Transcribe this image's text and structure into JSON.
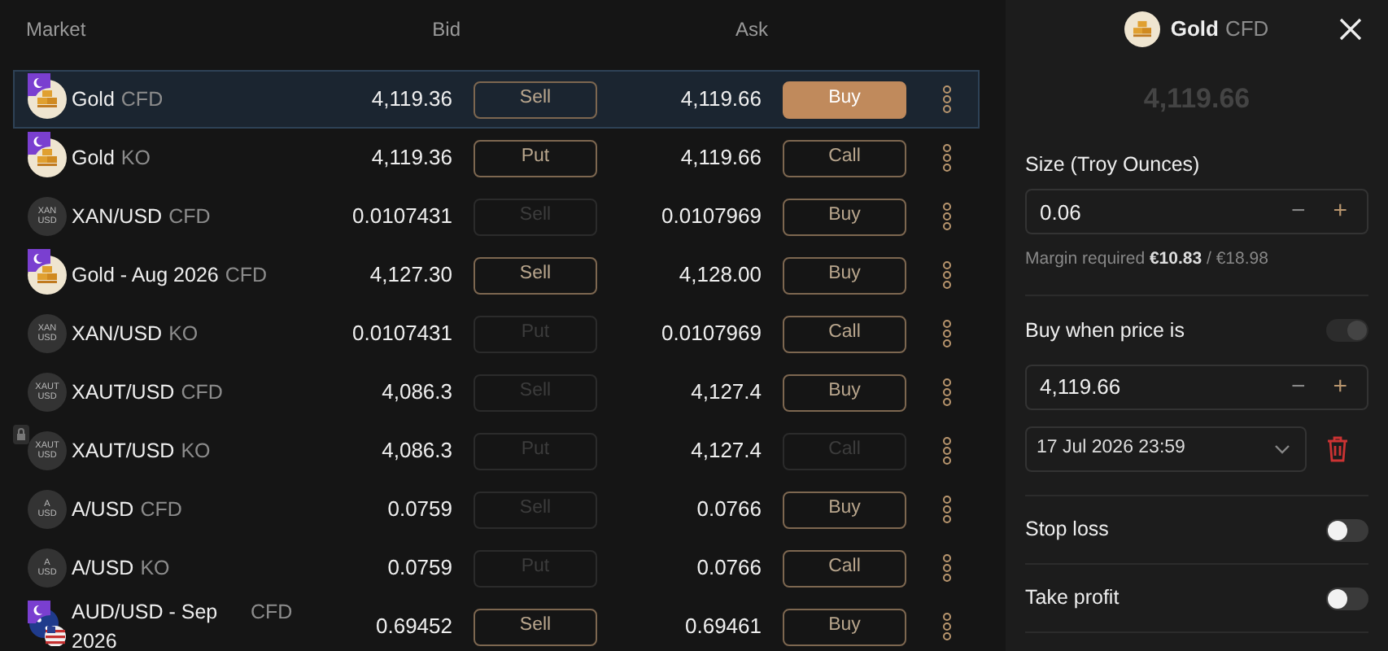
{
  "columns": {
    "market": "Market",
    "bid": "Bid",
    "ask": "Ask"
  },
  "rows": [
    {
      "name": "Gold",
      "type": "CFD",
      "kind": "bullion",
      "closed": true,
      "locked": false,
      "bid": "4,119.36",
      "sell": "Sell",
      "sell_enabled": true,
      "ask": "4,119.66",
      "buy": "Buy",
      "buy_enabled": true,
      "selected": true
    },
    {
      "name": "Gold",
      "type": "KO",
      "kind": "bullion",
      "closed": true,
      "locked": false,
      "bid": "4,119.36",
      "sell": "Put",
      "sell_enabled": true,
      "ask": "4,119.66",
      "buy": "Call",
      "buy_enabled": true,
      "selected": false
    },
    {
      "name": "XAN/USD",
      "type": "CFD",
      "kind": "coin",
      "icon_text": [
        "XAN",
        "USD"
      ],
      "closed": false,
      "locked": false,
      "bid": "0.0107431",
      "sell": "Sell",
      "sell_enabled": false,
      "ask": "0.0107969",
      "buy": "Buy",
      "buy_enabled": true,
      "selected": false
    },
    {
      "name": "Gold - Aug 2026",
      "type": "CFD",
      "kind": "bullion",
      "closed": true,
      "locked": false,
      "bid": "4,127.30",
      "sell": "Sell",
      "sell_enabled": true,
      "ask": "4,128.00",
      "buy": "Buy",
      "buy_enabled": true,
      "selected": false
    },
    {
      "name": "XAN/USD",
      "type": "KO",
      "kind": "coin",
      "icon_text": [
        "XAN",
        "USD"
      ],
      "closed": false,
      "locked": false,
      "bid": "0.0107431",
      "sell": "Put",
      "sell_enabled": false,
      "ask": "0.0107969",
      "buy": "Call",
      "buy_enabled": true,
      "selected": false
    },
    {
      "name": "XAUT/USD",
      "type": "CFD",
      "kind": "coin",
      "icon_text": [
        "XAUT",
        "USD"
      ],
      "closed": false,
      "locked": false,
      "bid": "4,086.3",
      "sell": "Sell",
      "sell_enabled": false,
      "ask": "4,127.4",
      "buy": "Buy",
      "buy_enabled": true,
      "selected": false
    },
    {
      "name": "XAUT/USD",
      "type": "KO",
      "kind": "coin",
      "icon_text": [
        "XAUT",
        "USD"
      ],
      "closed": false,
      "locked": true,
      "bid": "4,086.3",
      "sell": "Put",
      "sell_enabled": false,
      "ask": "4,127.4",
      "buy": "Call",
      "buy_enabled": false,
      "selected": false
    },
    {
      "name": "A/USD",
      "type": "CFD",
      "kind": "coin",
      "icon_text": [
        "A",
        "USD"
      ],
      "closed": false,
      "locked": false,
      "bid": "0.0759",
      "sell": "Sell",
      "sell_enabled": false,
      "ask": "0.0766",
      "buy": "Buy",
      "buy_enabled": true,
      "selected": false
    },
    {
      "name": "A/USD",
      "type": "KO",
      "kind": "coin",
      "icon_text": [
        "A",
        "USD"
      ],
      "closed": false,
      "locked": false,
      "bid": "0.0759",
      "sell": "Put",
      "sell_enabled": false,
      "ask": "0.0766",
      "buy": "Call",
      "buy_enabled": true,
      "selected": false
    },
    {
      "name": "AUD/USD - Sep 2026",
      "type": "CFD",
      "kind": "flags",
      "closed": true,
      "locked": false,
      "bid": "0.69452",
      "sell": "Sell",
      "sell_enabled": true,
      "ask": "0.69461",
      "buy": "Buy",
      "buy_enabled": true,
      "selected": false
    }
  ],
  "panel": {
    "title": "Gold",
    "type": "CFD",
    "price": "4,119.66",
    "size_label": "Size (Troy Ounces)",
    "size_value": "0.06",
    "minus": "−",
    "plus": "+",
    "margin": "Margin required **€10.83** / €18.98",
    "limit_label": "Buy when price is",
    "limit_toggle": {
      "on": true,
      "disabled": true
    },
    "limit_value": "4,119.66",
    "expiry": "17 Jul 2026 23:59",
    "toggles": [
      {
        "label": "Stop loss",
        "on": false
      },
      {
        "label": "Take profit",
        "on": false
      }
    ]
  }
}
